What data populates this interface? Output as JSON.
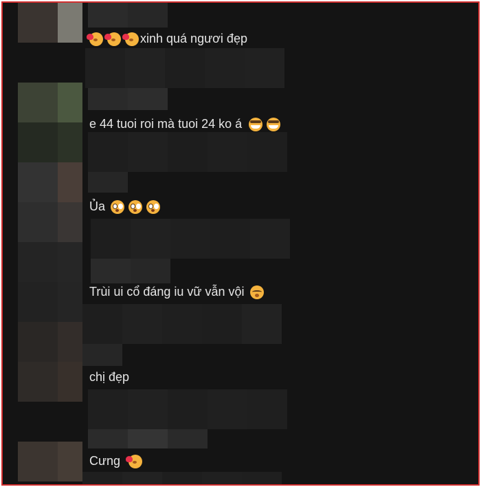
{
  "comments": [
    {
      "text": "xinh quá ngươi đẹp",
      "emojis_before": [
        "smiling-face-with-hearts",
        "smiling-face-with-hearts",
        "smiling-face-with-hearts"
      ],
      "emojis_after": []
    },
    {
      "text": "e 44 tuoi roi mà tuoi 24 ko á",
      "emojis_before": [],
      "emojis_after": [
        "grinning-sweat-face",
        "grinning-sweat-face"
      ]
    },
    {
      "text": "Ủa",
      "emojis_before": [],
      "emojis_after": [
        "flushed-face",
        "flushed-face",
        "flushed-face"
      ]
    },
    {
      "text": "Trùi ui cổ đáng iu vữ vẫn vội",
      "emojis_before": [],
      "emojis_after": [
        "kissing-smiling-eyes-face"
      ]
    },
    {
      "text": "chị đẹp",
      "emojis_before": [],
      "emojis_after": []
    },
    {
      "text": "Cưng",
      "emojis_before": [],
      "emojis_after": [
        "smiling-face-with-hearts"
      ]
    }
  ],
  "colors": {
    "background": "#141414",
    "frame_border": "#d32f2f",
    "text": "#e6e6e6",
    "pixelated_block": "#262626"
  }
}
